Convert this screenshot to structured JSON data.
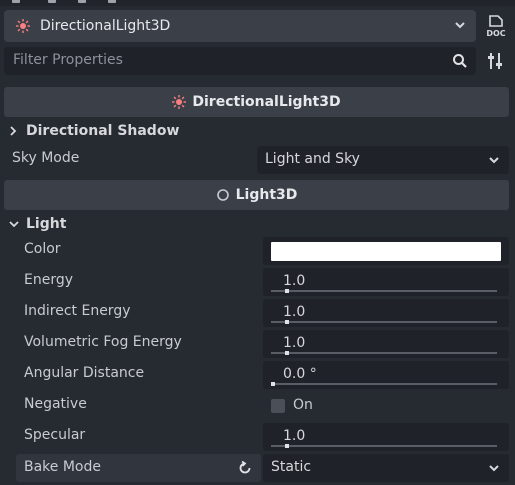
{
  "topbar": {},
  "node": {
    "name": "DirectionalLight3D",
    "icon": "directional-light-icon",
    "accent": "#fc7f7f"
  },
  "doc_button": {
    "icon": "doc-icon",
    "label": "DOC"
  },
  "filter": {
    "placeholder": "Filter Properties",
    "icon": "search-icon"
  },
  "class_header": {
    "label": "DirectionalLight3D"
  },
  "directional_shadow": {
    "label": "Directional Shadow"
  },
  "sky_mode": {
    "label": "Sky Mode",
    "value": "Light and Sky"
  },
  "light3d_header": {
    "label": "Light3D"
  },
  "light_group": {
    "label": "Light"
  },
  "props": {
    "color": {
      "label": "Color",
      "value": "#ffffff"
    },
    "energy": {
      "label": "Energy",
      "value": "1.0",
      "slider": 0.1
    },
    "indirect_energy": {
      "label": "Indirect Energy",
      "value": "1.0",
      "slider": 0.1
    },
    "volumetric_fog_energy": {
      "label": "Volumetric Fog Energy",
      "value": "1.0",
      "slider": 0.1
    },
    "angular_distance": {
      "label": "Angular Distance",
      "value": "0.0 °",
      "slider": 0.0
    },
    "negative": {
      "label": "Negative",
      "value": "On",
      "checked": false
    },
    "specular": {
      "label": "Specular",
      "value": "1.0",
      "slider": 0.1
    },
    "bake_mode": {
      "label": "Bake Mode",
      "value": "Static"
    }
  }
}
